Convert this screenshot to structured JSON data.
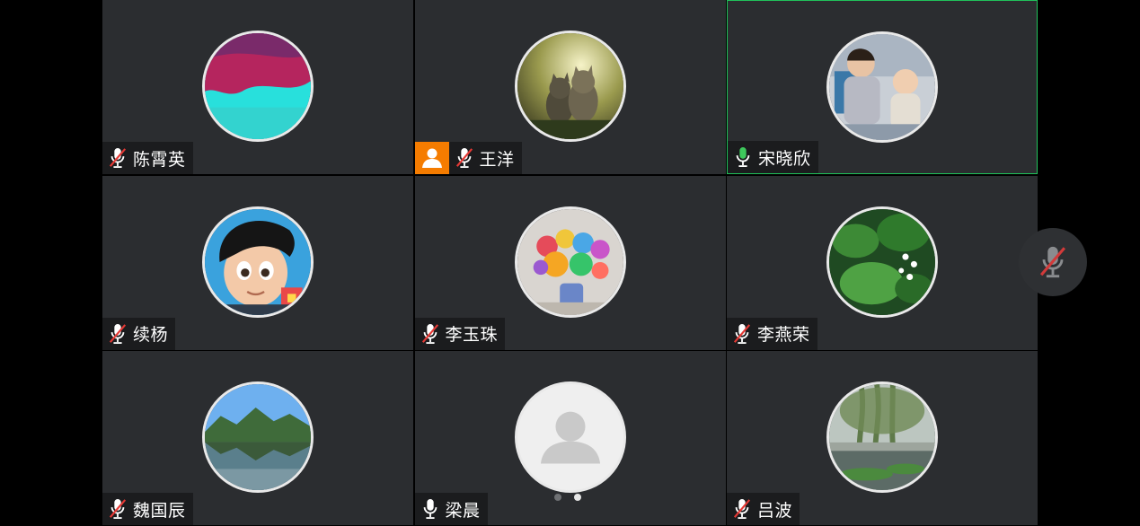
{
  "participants": [
    {
      "name": "陈霄英",
      "mic": "muted",
      "avatar": "photo-cyan-pink"
    },
    {
      "name": "王洋",
      "mic": "muted",
      "avatar": "photo-kittens",
      "host": true
    },
    {
      "name": "宋晓欣",
      "mic": "on",
      "avatar": "photo-children",
      "active_speaker": true
    },
    {
      "name": "续杨",
      "mic": "muted",
      "avatar": "photo-cartoon-boy"
    },
    {
      "name": "李玉珠",
      "mic": "muted",
      "avatar": "photo-flowers"
    },
    {
      "name": "李燕荣",
      "mic": "muted",
      "avatar": "photo-green-plant"
    },
    {
      "name": "魏国辰",
      "mic": "muted",
      "avatar": "photo-lake-mountains"
    },
    {
      "name": "梁晨",
      "mic": "on",
      "avatar": "default-person-icon"
    },
    {
      "name": "吕波",
      "mic": "muted",
      "avatar": "photo-willow-pond"
    }
  ],
  "pager": {
    "pages": 2,
    "current": 2
  },
  "floating_mic": {
    "state": "muted"
  },
  "colors": {
    "tile_bg": "#2b2d30",
    "active_border": "#20c15a",
    "host_badge": "#f57c00",
    "muted_slash": "#e53935",
    "mic_on": "#3ec85c"
  }
}
